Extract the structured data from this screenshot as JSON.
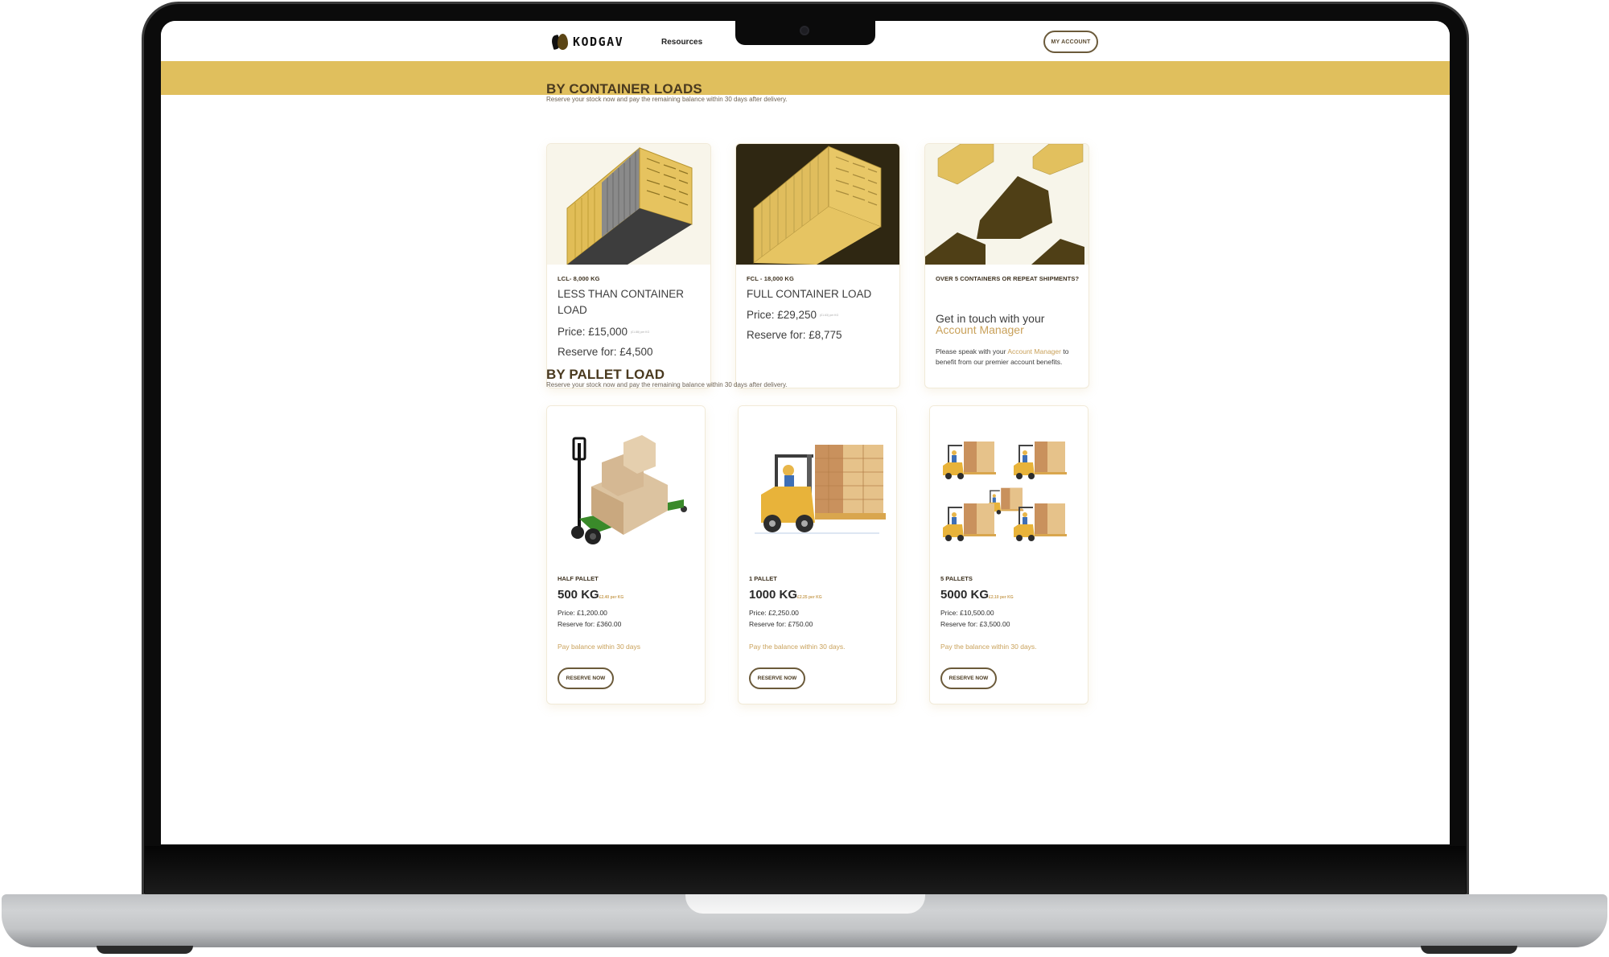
{
  "header": {
    "logo_text": "KODGAV",
    "nav": [
      {
        "label": "Resources"
      }
    ],
    "account_button": "MY ACCOUNT"
  },
  "colors": {
    "banner": "#e0bf5d",
    "heading": "#4a3a1f",
    "accent_gold": "#c9a15a",
    "dark_brown": "#2f2712"
  },
  "container_section": {
    "title": "BY CONTAINER LOADS",
    "subtitle": "Reserve your stock now and pay the remaining balance within 30 days after delivery.",
    "cards": [
      {
        "image": "yellow-container-open-side",
        "eyebrow": "LCL- 8,000 KG",
        "title": "LESS THAN CONTAINER LOAD",
        "price": "Price: £15,000",
        "per_kg": "(£1.88) per KG",
        "reserve": "Reserve for: £4,500"
      },
      {
        "image": "yellow-container-dark-bg",
        "eyebrow": "FCL - 18,000 KG",
        "title": "FULL CONTAINER LOAD",
        "price": "Price: £29,250",
        "per_kg": "(£1.63) per KG",
        "reserve": "Reserve for: £8,775"
      },
      {
        "image": "multiple-containers",
        "eyebrow": "OVER 5 CONTAINERS OR REPEAT SHIPMENTS?",
        "headline_prefix": "Get in touch with your",
        "headline_link": "Account Manager",
        "body_prefix": "Please speak with your",
        "body_link": "Account Manager",
        "body_suffix": "to benefit from our premier account benefits."
      }
    ]
  },
  "pallet_section": {
    "title": "BY PALLET LOAD",
    "subtitle": "Reserve your stock now and pay the remaining balance within 30 days after delivery.",
    "cards": [
      {
        "image": "pallet-jack-with-boxes",
        "eyebrow": "HALF PALLET",
        "weight": "500 KG",
        "per_kg": "£2.40 per KG",
        "price": "Price: £1,200.00",
        "reserve": "Reserve for: £360.00",
        "note": "Pay balance within 30 days",
        "button": "RESERVE NOW"
      },
      {
        "image": "forklift-single-pallet",
        "eyebrow": "1 PALLET",
        "weight": "1000 KG",
        "per_kg": "£2.25 per KG",
        "price": "Price: £2,250.00",
        "reserve": "Reserve for: £750.00",
        "note": "Pay the balance within 30 days.",
        "button": "RESERVE NOW"
      },
      {
        "image": "five-forklifts",
        "eyebrow": "5 PALLETS",
        "weight": "5000 KG",
        "per_kg": "£2.10 per KG",
        "price": "Price: £10,500.00",
        "reserve": "Reserve for: £3,500.00",
        "note": "Pay the balance within 30 days.",
        "button": "RESERVE NOW"
      }
    ]
  }
}
